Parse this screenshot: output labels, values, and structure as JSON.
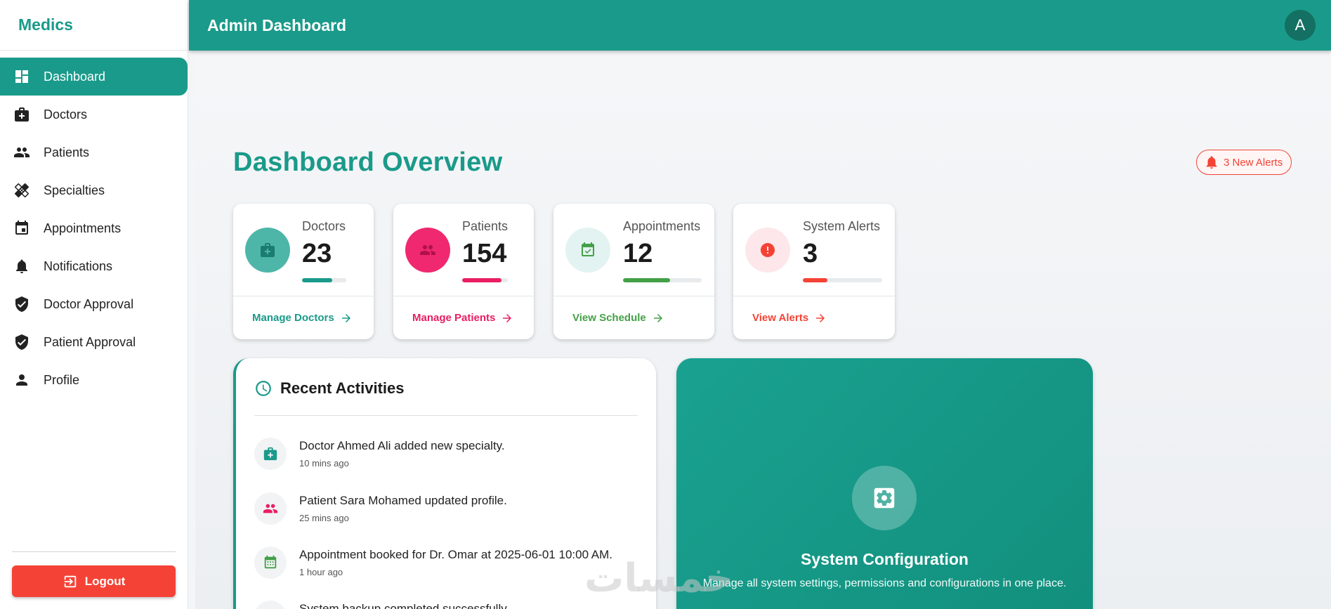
{
  "brand": "Medics",
  "topbar": {
    "title": "Admin Dashboard",
    "avatar": "A"
  },
  "sidebar": {
    "items": [
      {
        "label": "Dashboard",
        "icon": "dashboard-icon",
        "active": true
      },
      {
        "label": "Doctors",
        "icon": "medical-bag-icon"
      },
      {
        "label": "Patients",
        "icon": "people-icon"
      },
      {
        "label": "Specialties",
        "icon": "healing-icon"
      },
      {
        "label": "Appointments",
        "icon": "calendar-icon"
      },
      {
        "label": "Notifications",
        "icon": "bell-icon"
      },
      {
        "label": "Doctor Approval",
        "icon": "shield-check-icon"
      },
      {
        "label": "Patient Approval",
        "icon": "shield-check-icon"
      },
      {
        "label": "Profile",
        "icon": "person-icon"
      }
    ],
    "logout_label": "Logout"
  },
  "main": {
    "title": "Dashboard Overview",
    "alerts_badge": "3 New Alerts",
    "stats": [
      {
        "label": "Doctors",
        "value": "23",
        "action": "Manage Doctors",
        "color": "#1a9a8a",
        "progress": 0.68,
        "icon": "medical-bag-icon"
      },
      {
        "label": "Patients",
        "value": "154",
        "action": "Manage Patients",
        "color": "#e91e63",
        "progress": 0.86,
        "icon": "people-icon"
      },
      {
        "label": "Appointments",
        "value": "12",
        "action": "View Schedule",
        "color": "#43a047",
        "progress": 0.6,
        "icon": "calendar-check-icon"
      },
      {
        "label": "System Alerts",
        "value": "3",
        "action": "View Alerts",
        "color": "#f44336",
        "progress": 0.31,
        "icon": "alert-icon"
      }
    ],
    "activities": {
      "title": "Recent Activities",
      "items": [
        {
          "text": "Doctor Ahmed Ali added new specialty.",
          "time": "10 mins ago",
          "icon": "medical-bag-icon"
        },
        {
          "text": "Patient Sara Mohamed updated profile.",
          "time": "25 mins ago",
          "icon": "people-icon"
        },
        {
          "text": "Appointment booked for Dr. Omar at 2025-06-01 10:00 AM.",
          "time": "1 hour ago",
          "icon": "calendar-icon"
        },
        {
          "text": "System backup completed successfully.",
          "time": "",
          "icon": "backup-icon"
        }
      ]
    },
    "system_config": {
      "title": "System Configuration",
      "description": "Manage all system settings, permissions and configurations in one place."
    }
  },
  "watermark": "خمسات"
}
